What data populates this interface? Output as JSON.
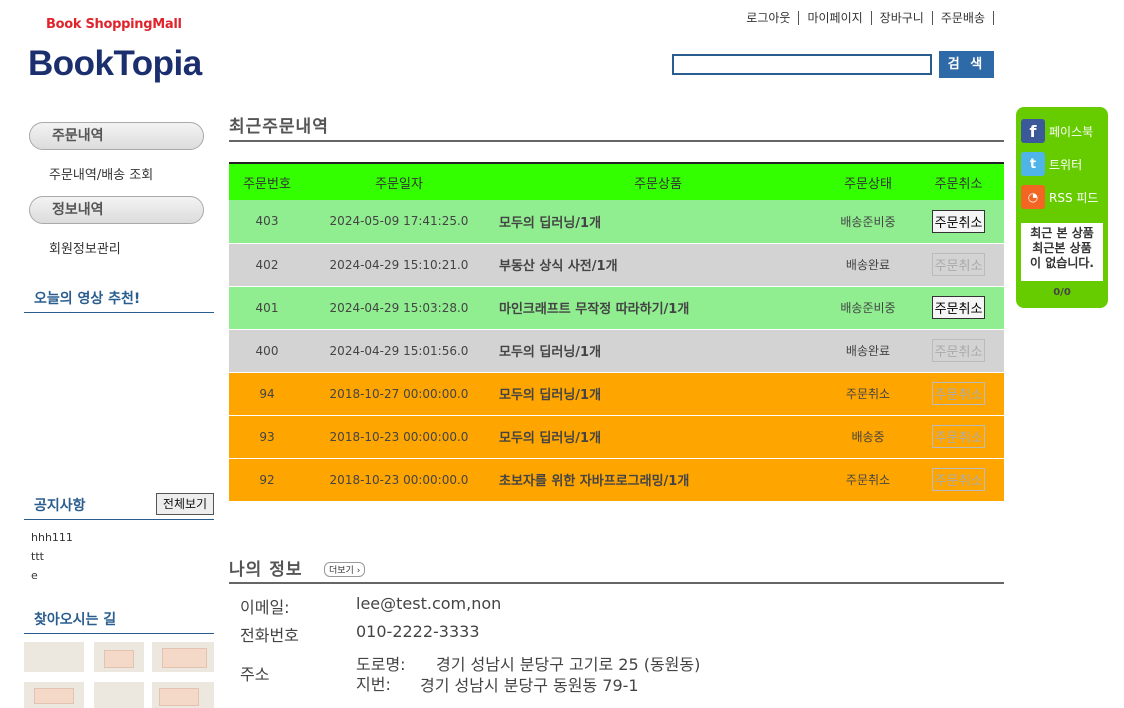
{
  "header": {
    "brand_sub": "Book ShoppingMall",
    "brand": "BookTopia",
    "nav": [
      "로그아웃",
      "마이페이지",
      "장바구니",
      "주문배송"
    ],
    "search_value": "",
    "search_button": "검 색"
  },
  "sidebar": {
    "order_section": "주문내역",
    "order_link": "주문내역/배송 조회",
    "info_section": "정보내역",
    "info_link": "회원정보관리",
    "video_heading": "오늘의 영상 추천!",
    "notice_heading": "공지사항",
    "notice_all_button": "전체보기",
    "notices": [
      "hhh111",
      "ttt",
      "e"
    ],
    "directions_heading": "찾아오시는 길"
  },
  "orders": {
    "title": "최근주문내역",
    "columns": [
      "주문번호",
      "주문일자",
      "주문상품",
      "주문상태",
      "주문취소"
    ],
    "rows": [
      {
        "no": "403",
        "date": "2024-05-09 17:41:25.0",
        "product": "모두의 딥러닝/1개",
        "status": "배송준비중",
        "cancel": "주문취소",
        "style": "green",
        "enabled": true
      },
      {
        "no": "402",
        "date": "2024-04-29 15:10:21.0",
        "product": "부동산 상식 사전/1개",
        "status": "배송완료",
        "cancel": "주문취소",
        "style": "gray",
        "enabled": false
      },
      {
        "no": "401",
        "date": "2024-04-29 15:03:28.0",
        "product": "마인크래프트 무작정 따라하기/1개",
        "status": "배송준비중",
        "cancel": "주문취소",
        "style": "green",
        "enabled": true
      },
      {
        "no": "400",
        "date": "2024-04-29 15:01:56.0",
        "product": "모두의 딥러닝/1개",
        "status": "배송완료",
        "cancel": "주문취소",
        "style": "gray",
        "enabled": false
      },
      {
        "no": "94",
        "date": "2018-10-27 00:00:00.0",
        "product": "모두의 딥러닝/1개",
        "status": "주문취소",
        "cancel": "주문취소",
        "style": "orange",
        "enabled": false
      },
      {
        "no": "93",
        "date": "2018-10-23 00:00:00.0",
        "product": "모두의 딥러닝/1개",
        "status": "배송중",
        "cancel": "주문취소",
        "style": "orange",
        "enabled": false
      },
      {
        "no": "92",
        "date": "2018-10-23 00:00:00.0",
        "product": "초보자를 위한 자바프로그래밍/1개",
        "status": "주문취소",
        "cancel": "주문취소",
        "style": "orange",
        "enabled": false
      }
    ]
  },
  "myinfo": {
    "title": "나의 정보",
    "more_button": "더보기 ›",
    "email_label": "이메일:",
    "email_value": "lee@test.com,non",
    "phone_label": "전화번호",
    "phone_value": "010-2222-3333",
    "address_label": "주소",
    "road_label": "도로명:",
    "road_value": "경기 성남시 분당구 고기로 25 (동원동)",
    "lot_label": "지번:",
    "lot_value": "경기 성남시 분당구 동원동 79-1"
  },
  "widget": {
    "facebook": "페이스북",
    "twitter": "트위터",
    "rss": "RSS 피드",
    "recent_title": "최근 본 상품",
    "recent_empty_1": "최근본 상품",
    "recent_empty_2": "이 없습니다.",
    "counter": "0/0"
  },
  "colors": {
    "header_row": "#33ff00",
    "green_row": "#90ee90",
    "gray_row": "#d3d3d3",
    "orange_row": "#ffa500",
    "brand": "#1b2e6e",
    "widget": "#66cc00"
  }
}
